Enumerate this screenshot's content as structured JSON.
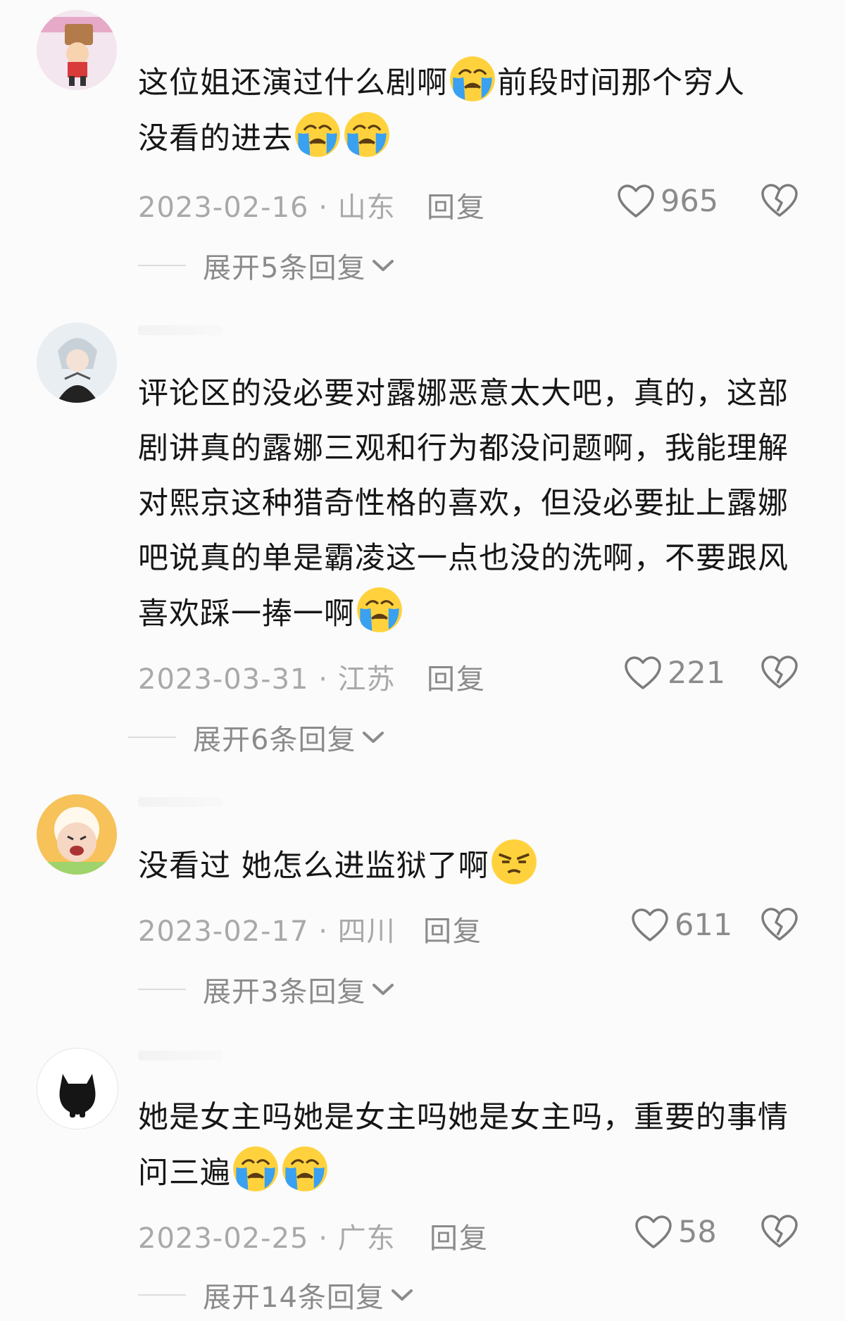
{
  "comments": [
    {
      "text_parts": [
        "这位姐还演过什么剧啊",
        "前段时间那个穷人",
        "没看的进去"
      ],
      "emojis": [
        "crying-emoji",
        "crying-emoji",
        "crying-emoji"
      ],
      "date": "2023-02-16",
      "location": "山东",
      "reply_label": "回复",
      "likes": "965",
      "expand_label": "展开5条回复"
    },
    {
      "text_parts": [
        "评论区的没必要对露娜恶意太大吧，真的，这部剧讲真的露娜三观和行为都没问题啊，我能理解对熙京这种猎奇性格的喜欢，但没必要扯上露娜吧说真的单是霸凌这一点也没的洗啊，不要跟风喜欢踩一捧一啊"
      ],
      "emojis": [
        "crying-emoji"
      ],
      "date": "2023-03-31",
      "location": "江苏",
      "reply_label": "回复",
      "likes": "221",
      "expand_label": "展开6条回复"
    },
    {
      "text_parts": [
        "没看过 她怎么进监狱了啊"
      ],
      "emojis": [
        "annoyed-emoji"
      ],
      "date": "2023-02-17",
      "location": "四川",
      "reply_label": "回复",
      "likes": "611",
      "expand_label": "展开3条回复"
    },
    {
      "text_parts": [
        "她是女主吗她是女主吗她是女主吗，重要的事情问三遍"
      ],
      "emojis": [
        "crying-emoji",
        "crying-emoji"
      ],
      "date": "2023-02-25",
      "location": "广东",
      "reply_label": "回复",
      "likes": "58",
      "expand_label": "展开14条回复"
    }
  ],
  "meta_separator": "·",
  "icons": {
    "like": "heart-outline-icon",
    "dislike": "broken-heart-icon",
    "expand": "chevron-down-icon"
  },
  "colors": {
    "background": "#fbfbfb",
    "text": "#161616",
    "meta": "#a9a9a9",
    "action": "#8b8b8b"
  }
}
